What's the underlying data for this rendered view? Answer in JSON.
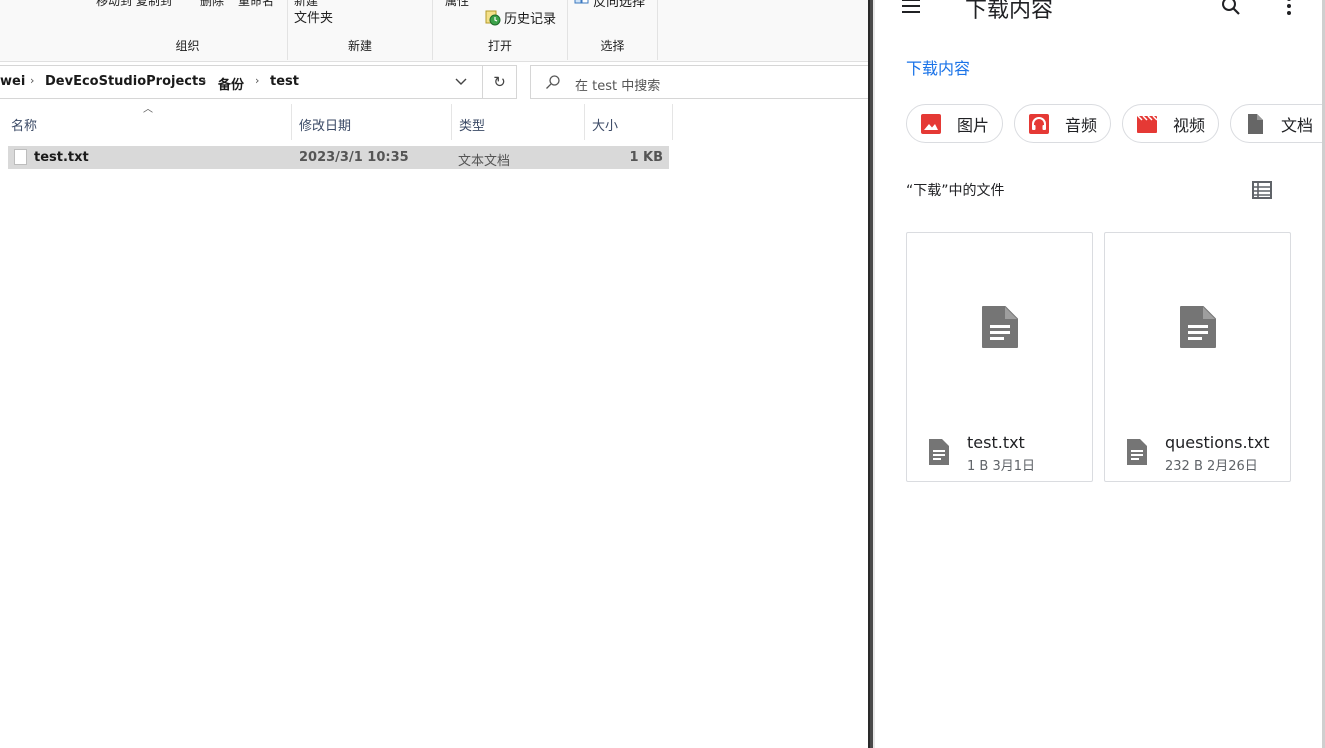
{
  "explorer": {
    "ribbon": {
      "clipped_top_left": "移动到 复制到",
      "clipped_delete": "删除",
      "clipped_rename": "重命名",
      "new_folder_top": "新建",
      "new_folder_label": "文件夹",
      "properties_label": "属性",
      "history_label": "历史记录",
      "invert_selection_label": "反向选择",
      "groups": {
        "organize": "组织",
        "new": "新建",
        "open": "打开",
        "select": "选择"
      }
    },
    "address": {
      "crumbs": [
        "wei",
        "DevEcoStudioProjects",
        "备份",
        "test"
      ],
      "refresh_glyph": "↻",
      "dropdown_glyph": "⌄"
    },
    "search": {
      "placeholder": "在 test 中搜索"
    },
    "columns": {
      "name": "名称",
      "modified": "修改日期",
      "type": "类型",
      "size": "大小"
    },
    "files": [
      {
        "name": "test.txt",
        "modified": "2023/3/1 10:35",
        "type": "文本文档",
        "size": "1 KB"
      }
    ]
  },
  "downloads": {
    "title": "下载内容",
    "breadcrumb": "下载内容",
    "chips": [
      {
        "label": "图片",
        "icon": "image-icon",
        "color": "#e53935"
      },
      {
        "label": "音频",
        "icon": "headphones-icon",
        "color": "#e53935"
      },
      {
        "label": "视频",
        "icon": "movie-icon",
        "color": "#e53935"
      },
      {
        "label": "文档",
        "icon": "document-icon",
        "color": "#666666"
      }
    ],
    "section_title": "“下载”中的文件",
    "files": [
      {
        "name": "test.txt",
        "meta": "1 B 3月1日"
      },
      {
        "name": "questions.txt",
        "meta": "232 B 2月26日"
      }
    ],
    "colors": {
      "accent": "#1a73e8",
      "icon_gray": "#757575",
      "chip_red": "#e53935"
    }
  }
}
